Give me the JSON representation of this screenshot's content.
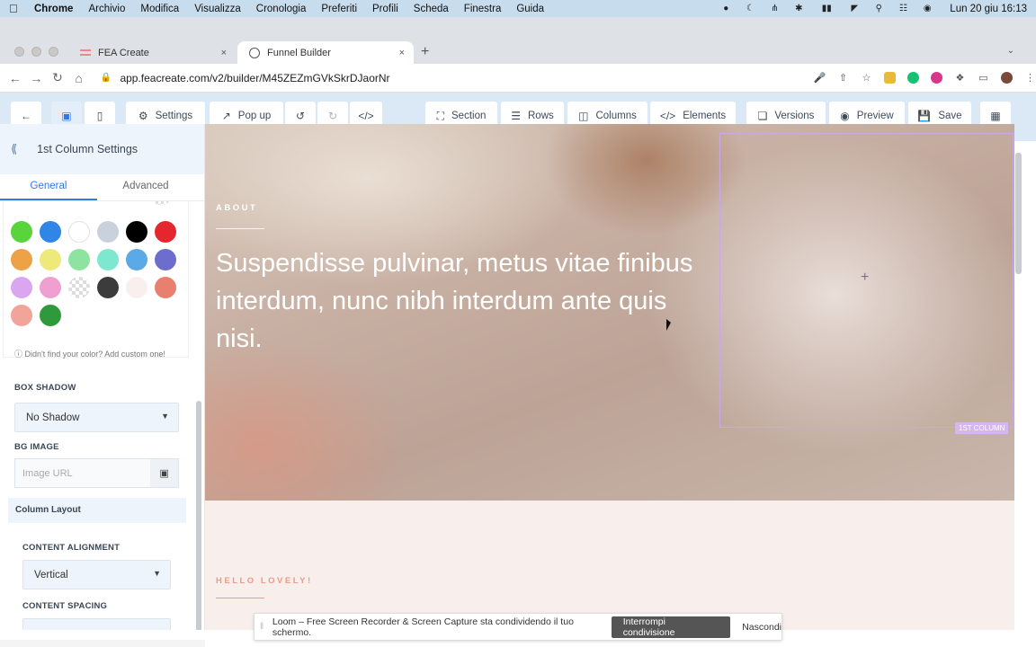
{
  "menubar": {
    "app": "Chrome",
    "items": [
      "Archivio",
      "Modifica",
      "Visualizza",
      "Cronologia",
      "Preferiti",
      "Profili",
      "Scheda",
      "Finestra",
      "Guida"
    ],
    "clock": "Lun 20 giu  16:13"
  },
  "tabs": {
    "inactive": "FEA Create",
    "active": "Funnel Builder",
    "close": "×",
    "new": "+"
  },
  "address": {
    "url": "app.feacreate.com/v2/builder/M45ZEZmGVkSkrDJaorNr"
  },
  "toolbar": {
    "settings": "Settings",
    "popup": "Pop up",
    "section": "Section",
    "rows": "Rows",
    "columns": "Columns",
    "elements": "Elements",
    "versions": "Versions",
    "preview": "Preview",
    "save": "Save"
  },
  "sidebar": {
    "title": "1st Column Settings",
    "tab_general": "General",
    "tab_advanced": "Advanced",
    "color_note": "Didn't find your color? Add custom one!",
    "swatches": [
      "#5ad43c",
      "#2f86e6",
      "#ffffff",
      "#c9d1dc",
      "#000000",
      "#e5262f",
      "#eea247",
      "#ede97a",
      "#8ee3a0",
      "#7de7cf",
      "#5ba9e7",
      "#6c6dcc",
      "#d9a6ef",
      "#ef9fd0",
      "transparent",
      "#3c3c3c",
      "#f9efee",
      "#e88070",
      "#f0a49a",
      "#2f9a3c"
    ],
    "box_shadow_label": "BOX SHADOW",
    "box_shadow_value": "No Shadow",
    "bg_image_label": "BG IMAGE",
    "bg_image_placeholder": "Image URL",
    "column_layout": "Column Layout",
    "content_alignment_label": "CONTENT ALIGNMENT",
    "content_alignment_value": "Vertical",
    "content_spacing_label": "CONTENT SPACING"
  },
  "canvas": {
    "about": "ABOUT",
    "headline": "Suspendisse pulvinar, metus vitae finibus interdum, nunc nibh interdum ante quis nisi.",
    "column_label": "1ST COLUMN",
    "column_plus": "+",
    "hello": "HELLO LOVELY!"
  },
  "loom": {
    "message": "Loom – Free Screen Recorder & Screen Capture sta condividendo il tuo schermo.",
    "stop": "Interrompi condivisione",
    "hide": "Nascondi"
  },
  "colors": {
    "accent": "#2d7be5",
    "toolbar_bg": "#dbe8f6",
    "column_outline": "#caa7e6",
    "hello_text": "#e99c86"
  }
}
